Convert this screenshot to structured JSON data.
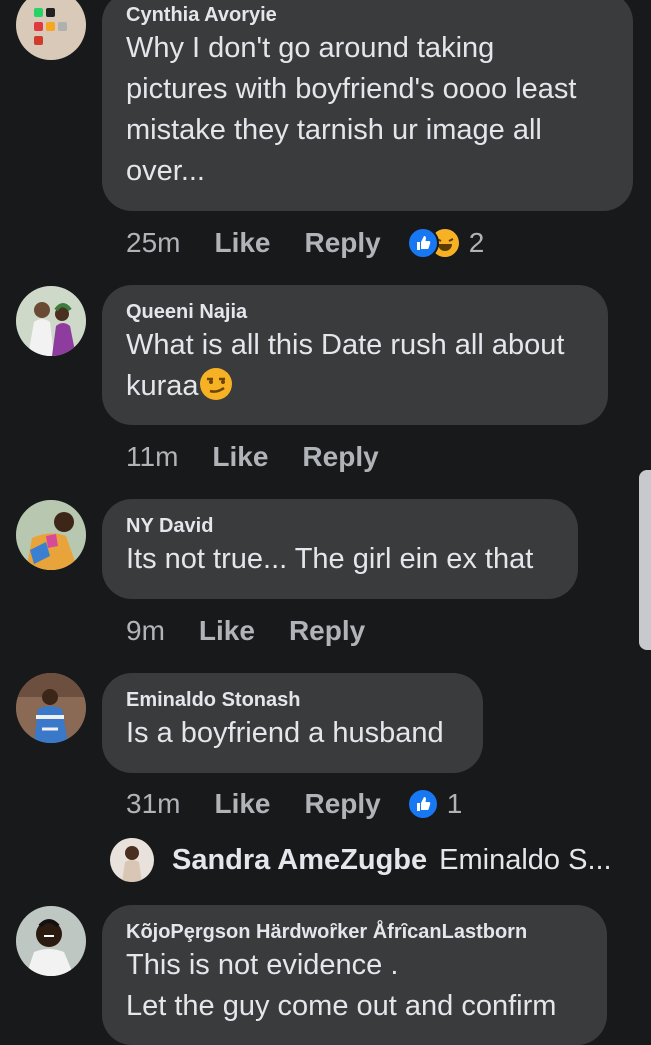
{
  "comments": [
    {
      "author": "Cynthia Avoryie",
      "lines": [
        "Why I don't go around taking",
        "pictures with boyfriend's oooo least",
        "mistake they tarnish ur image all",
        "over..."
      ],
      "time": "25m",
      "like_label": "Like",
      "reply_label": "Reply",
      "reactions": [
        "like-icon",
        "laugh-icon"
      ],
      "reaction_count": "2"
    },
    {
      "author": "Queeni Najia",
      "lines": [
        "What is all this Date rush all about",
        "kuraa"
      ],
      "emoji": "smirk-emoji",
      "time": "11m",
      "like_label": "Like",
      "reply_label": "Reply"
    },
    {
      "author": "NY David",
      "lines": [
        "Its not true... The girl ein ex that"
      ],
      "time": "9m",
      "like_label": "Like",
      "reply_label": "Reply"
    },
    {
      "author": "Eminaldo Stonash",
      "lines": [
        "Is a boyfriend a husband"
      ],
      "time": "31m",
      "like_label": "Like",
      "reply_label": "Reply",
      "reactions": [
        "like-icon"
      ],
      "reaction_count": "1"
    },
    {
      "author": "KõjoPȩrgson Härdwoȓker ÅfrȋcanLastborn",
      "lines": [
        "This is not evidence .",
        "Let the guy come out and confirm"
      ]
    }
  ],
  "reply_preview": {
    "name": "Sandra AmeZugbe",
    "text": "Eminaldo S..."
  },
  "colors": {
    "background": "#18191a",
    "bubble": "#3a3b3c",
    "text": "#e4e6eb",
    "meta": "#b0b3b8",
    "like_blue": "#1877f2",
    "laugh_yellow": "#f7b125"
  }
}
